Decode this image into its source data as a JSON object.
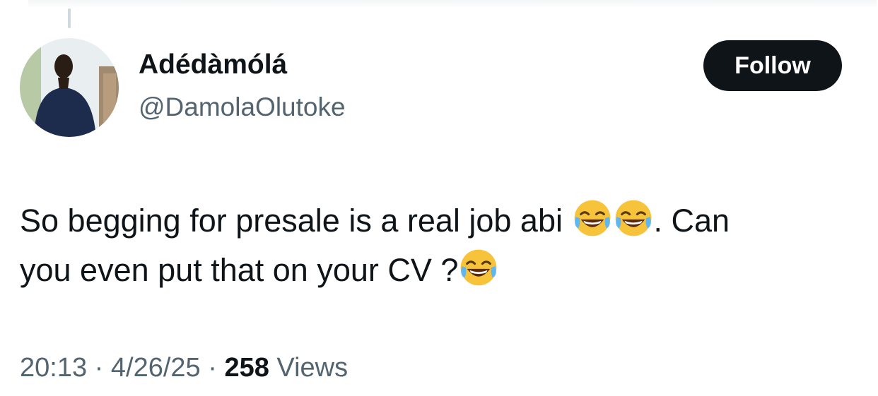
{
  "author": {
    "display_name": "Adédàmólá",
    "handle": "@DamolaOlutoke",
    "avatar_icon": "profile-photo"
  },
  "follow_button": {
    "label": "Follow"
  },
  "tweet": {
    "line1_text": "So begging for presale is a real job abi ",
    "line1_after_emoji": ". Can",
    "line2_text": "you even put that on your CV ?",
    "emoji_icon": "face-with-tears-of-joy-icon"
  },
  "meta": {
    "time": "20:13",
    "separator": "·",
    "date": "4/26/25",
    "views_count": "258",
    "views_label": "Views"
  },
  "colors": {
    "text": "#0f1419",
    "secondary": "#536471",
    "button_bg": "#0f1419",
    "button_text": "#ffffff"
  }
}
